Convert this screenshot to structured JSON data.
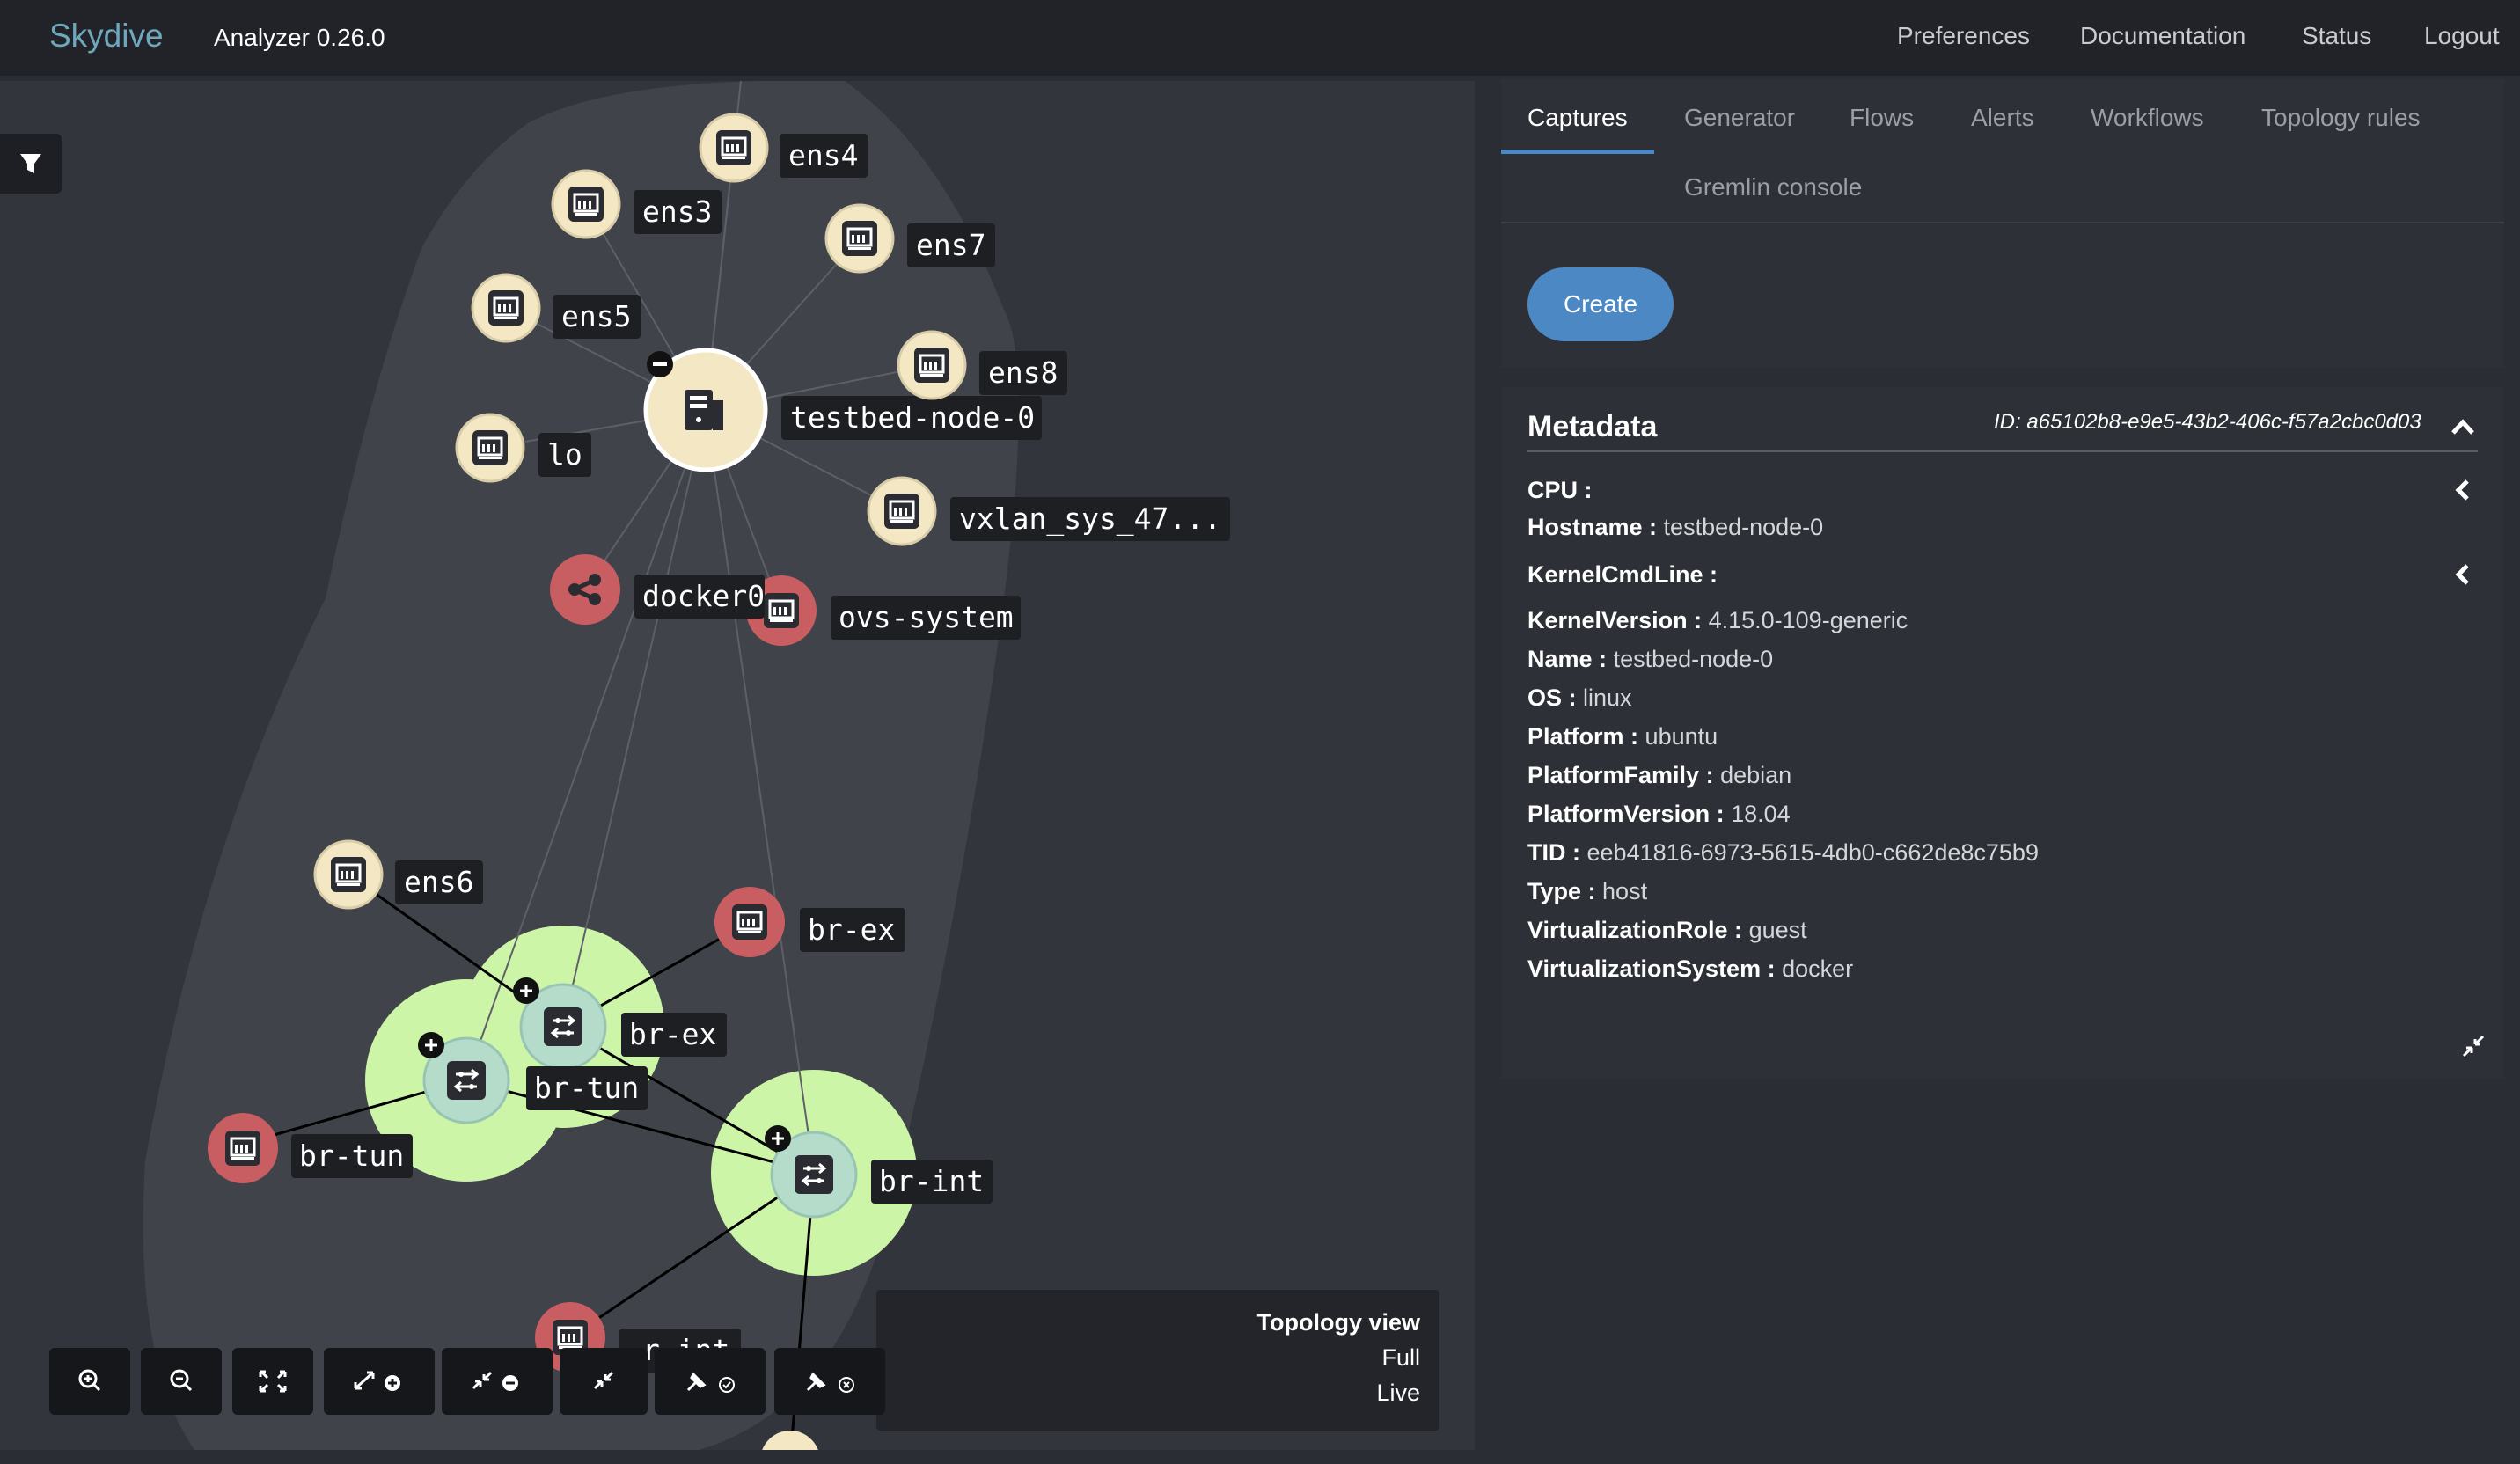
{
  "navbar": {
    "brand": "Skydive",
    "version": "Analyzer 0.26.0",
    "links": [
      "Preferences",
      "Documentation",
      "Status",
      "Logout"
    ]
  },
  "topology": {
    "nodes": {
      "ens4": "ens4",
      "ens3": "ens3",
      "ens7": "ens7",
      "ens5": "ens5",
      "ens8": "ens8",
      "host": "testbed-node-0",
      "lo": "lo",
      "vxlan": "vxlan_sys_47...",
      "docker0": "docker0",
      "ovs_system": "ovs-system",
      "ens6": "ens6",
      "br_ex_port": "br-ex",
      "br_ex": "br-ex",
      "br_tun": "br-tun",
      "br_tun_port": "br-tun",
      "br_int": "br-int",
      "br_int_port_partial": "r-int"
    },
    "view_info": {
      "title": "Topology view",
      "mode": "Full",
      "state": "Live"
    },
    "toolbar_icons": [
      "zoom-in-icon",
      "zoom-out-icon",
      "fit-screen-icon",
      "expand-all-icon",
      "collapse-all-icon",
      "collapse-icon",
      "pin-all-icon",
      "unpin-all-icon"
    ]
  },
  "tabs": [
    "Captures",
    "Generator",
    "Flows",
    "Alerts",
    "Workflows",
    "Topology rules",
    "Gremlin console"
  ],
  "captures": {
    "create_label": "Create"
  },
  "metadata": {
    "title": "Metadata",
    "id": "ID: a65102b8-e9e5-43b2-406c-f57a2cbc0d03",
    "fields": [
      {
        "key": "CPU",
        "value": ""
      },
      {
        "key": "Hostname",
        "value": "testbed-node-0"
      },
      {
        "key": "KernelCmdLine",
        "value": ""
      },
      {
        "key": "KernelVersion",
        "value": "4.15.0-109-generic"
      },
      {
        "key": "Name",
        "value": "testbed-node-0"
      },
      {
        "key": "OS",
        "value": "linux"
      },
      {
        "key": "Platform",
        "value": "ubuntu"
      },
      {
        "key": "PlatformFamily",
        "value": "debian"
      },
      {
        "key": "PlatformVersion",
        "value": "18.04"
      },
      {
        "key": "TID",
        "value": "eeb41816-6973-5615-4db0-c662de8c75b9"
      },
      {
        "key": "Type",
        "value": "host"
      },
      {
        "key": "VirtualizationRole",
        "value": "guest"
      },
      {
        "key": "VirtualizationSystem",
        "value": "docker"
      }
    ]
  }
}
